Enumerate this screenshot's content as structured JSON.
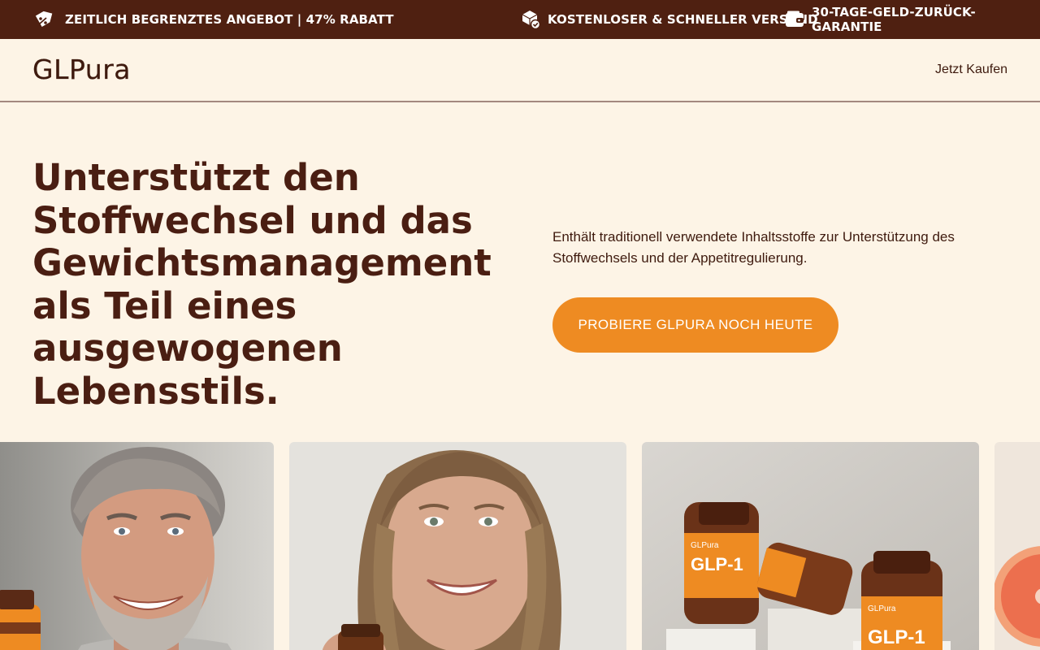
{
  "announcement": {
    "offer": "ZEITLICH BEGRENZTES ANGEBOT | 47% RABATT",
    "shipping": "KOSTENLOSER & SCHNELLER VERSAND",
    "guarantee": "30-TAGE-GELD-ZURÜCK-GARANTIE",
    "icons": [
      "discount-tag-icon",
      "package-check-icon",
      "wallet-icon"
    ]
  },
  "header": {
    "logo": "GLPura",
    "nav_buy": "Jetzt Kaufen"
  },
  "hero": {
    "title": "Unterstützt den Stoffwechsel und das Gewichtsmanagement als Teil eines ausgewogenen Lebensstils.",
    "description": "Enthält traditionell verwendete Inhaltsstoffe zur Unterstützung des Stoffwechsels und der Appetitregulierung.",
    "cta": "PROBIERE GLPURA NOCH HEUTE"
  },
  "products": {
    "brand": "GLPura",
    "name": "GLP-1"
  },
  "colors": {
    "topbar": "#4f2011",
    "background": "#fdf4e6",
    "text": "#4a1e12",
    "accent": "#ee8b22"
  }
}
